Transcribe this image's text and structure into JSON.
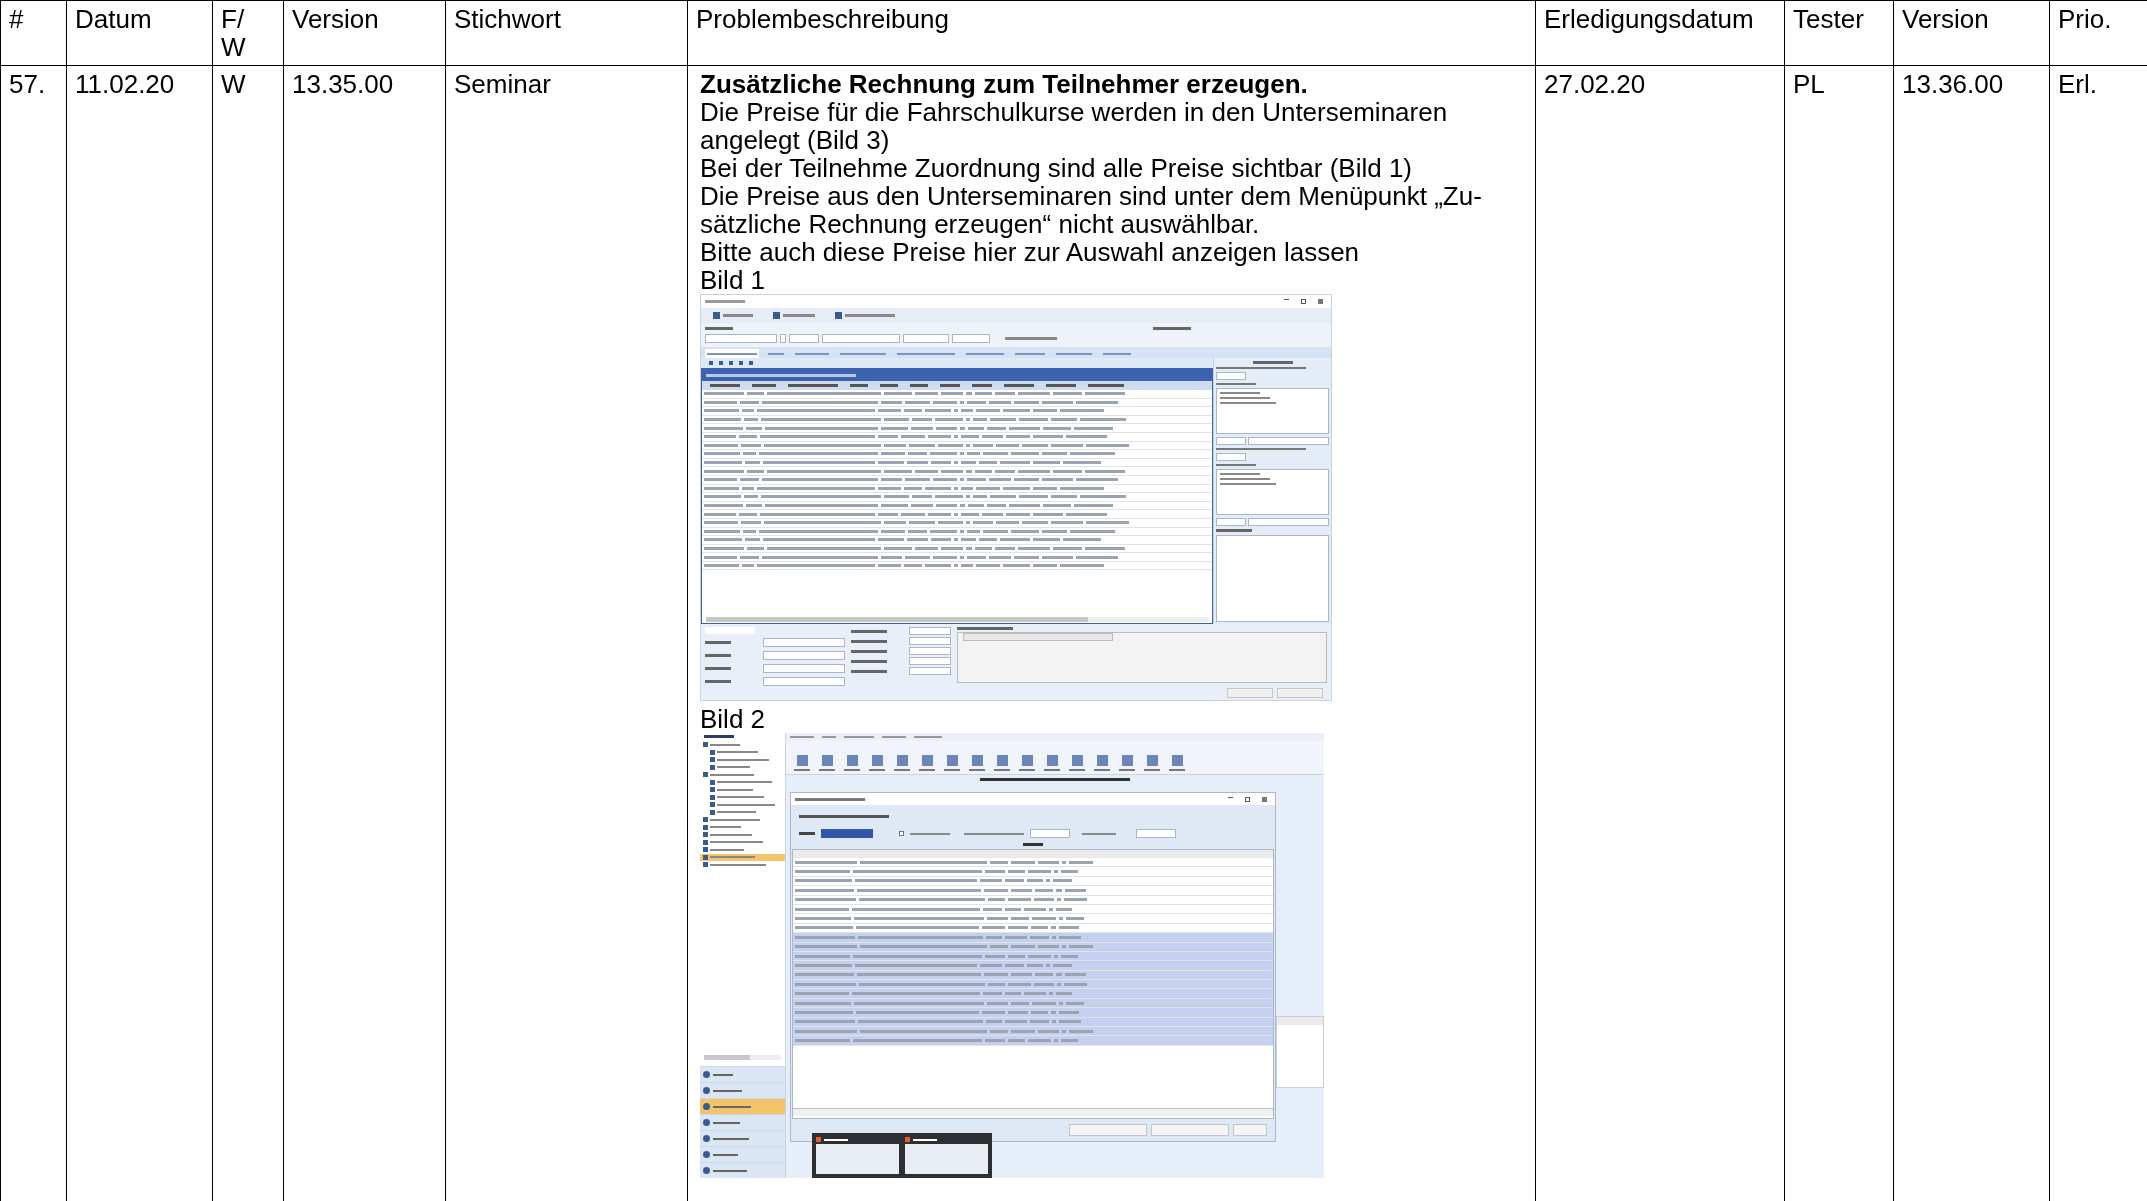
{
  "table": {
    "columns": [
      "#",
      "Datum",
      "F/ W",
      "Version",
      "Stichwort",
      "Problembeschreibung",
      "Erledigungsdatum",
      "Tester",
      "Version",
      "Prio."
    ],
    "row": {
      "cells_before": [
        "57.",
        "11.02.20",
        "W",
        "13.35.00",
        "Seminar"
      ],
      "cells_after": [
        "27.02.20",
        "PL",
        "13.36.00",
        "Erl."
      ],
      "description": {
        "title": "Zusätzliche Rechnung zum Teilnehmer erzeugen.",
        "paragraphs": [
          "Die Preise für die Fahrschulkurse werden in den Unterseminaren angelegt (Bild 3)",
          "Bei der Teilnehme Zuordnung sind alle Preise sichtbar (Bild 1)",
          "Die Preise aus den Unterseminaren sind unter dem Menüpunkt „Zu-sätzliche Rechnung erzeugen“ nicht auswählbar.",
          "Bitte auch diese Preise hier zur Auswahl anzeigen lassen"
        ],
        "figures": [
          {
            "caption": "Bild 1",
            "kind": "participant_form"
          },
          {
            "caption": "Bild 2",
            "kind": "invoice_dialog"
          }
        ]
      }
    }
  }
}
